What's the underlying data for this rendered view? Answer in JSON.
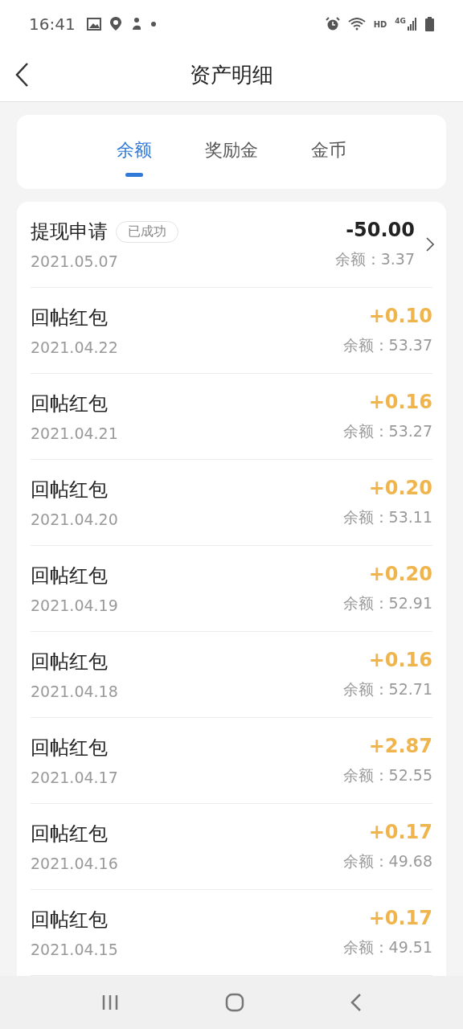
{
  "status_bar": {
    "time": "16:41",
    "hd": "HD",
    "network": "4G"
  },
  "header": {
    "title": "资产明细"
  },
  "tabs": [
    {
      "label": "余额",
      "selected": true
    },
    {
      "label": "奖励金",
      "selected": false
    },
    {
      "label": "金币",
      "selected": false
    }
  ],
  "records": [
    {
      "kind": "withdrawal",
      "title": "提现申请",
      "status": "已成功",
      "date": "2021.05.07",
      "amount": "-50.00",
      "balance": "余额：3.37"
    },
    {
      "kind": "reward",
      "title": "回帖红包",
      "date": "2021.04.22",
      "amount": "+0.10",
      "balance": "余额：53.37"
    },
    {
      "kind": "reward",
      "title": "回帖红包",
      "date": "2021.04.21",
      "amount": "+0.16",
      "balance": "余额：53.27"
    },
    {
      "kind": "reward",
      "title": "回帖红包",
      "date": "2021.04.20",
      "amount": "+0.20",
      "balance": "余额：53.11"
    },
    {
      "kind": "reward",
      "title": "回帖红包",
      "date": "2021.04.19",
      "amount": "+0.20",
      "balance": "余额：52.91"
    },
    {
      "kind": "reward",
      "title": "回帖红包",
      "date": "2021.04.18",
      "amount": "+0.16",
      "balance": "余额：52.71"
    },
    {
      "kind": "reward",
      "title": "回帖红包",
      "date": "2021.04.17",
      "amount": "+2.87",
      "balance": "余额：52.55"
    },
    {
      "kind": "reward",
      "title": "回帖红包",
      "date": "2021.04.16",
      "amount": "+0.17",
      "balance": "余额：49.68"
    },
    {
      "kind": "reward",
      "title": "回帖红包",
      "date": "2021.04.15",
      "amount": "+0.17",
      "balance": "余额：49.51"
    }
  ]
}
